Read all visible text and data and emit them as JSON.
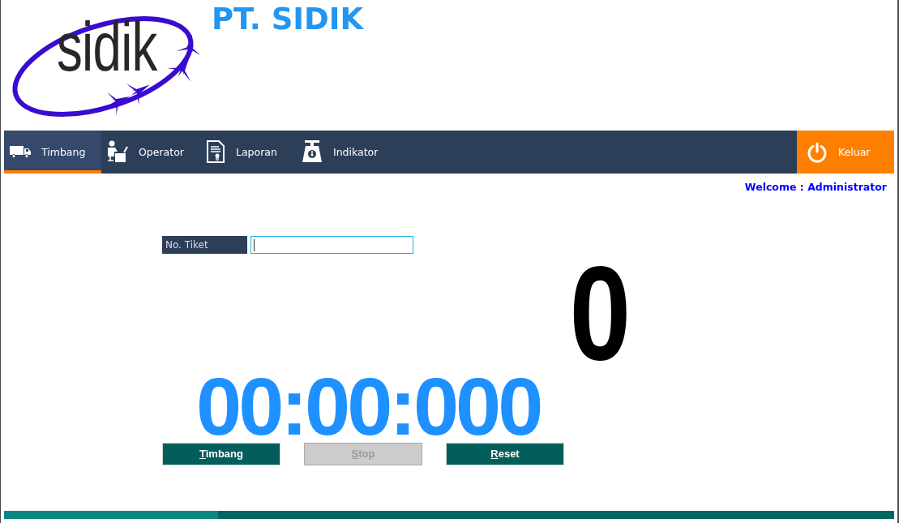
{
  "header": {
    "logo_text": "sidik",
    "company": "PT. SIDIK"
  },
  "nav": {
    "tabs": [
      {
        "label": "Timbang",
        "selected": true
      },
      {
        "label": "Operator",
        "selected": false
      },
      {
        "label": "Laporan",
        "selected": false
      },
      {
        "label": "Indikator",
        "selected": false
      }
    ],
    "logout": {
      "label": "Keluar"
    }
  },
  "welcome": "Welcome : Administrator",
  "ticket": {
    "label": "No. Tiket",
    "focused": true
  },
  "counter": {
    "digit": "0"
  },
  "timer": "00:00:000",
  "buttons": [
    {
      "label": "Timbang",
      "disabled": false
    },
    {
      "label": "Stop",
      "disabled": true
    },
    {
      "label": "Reset",
      "disabled": false
    }
  ],
  "progress": {
    "level": 0.24
  }
}
